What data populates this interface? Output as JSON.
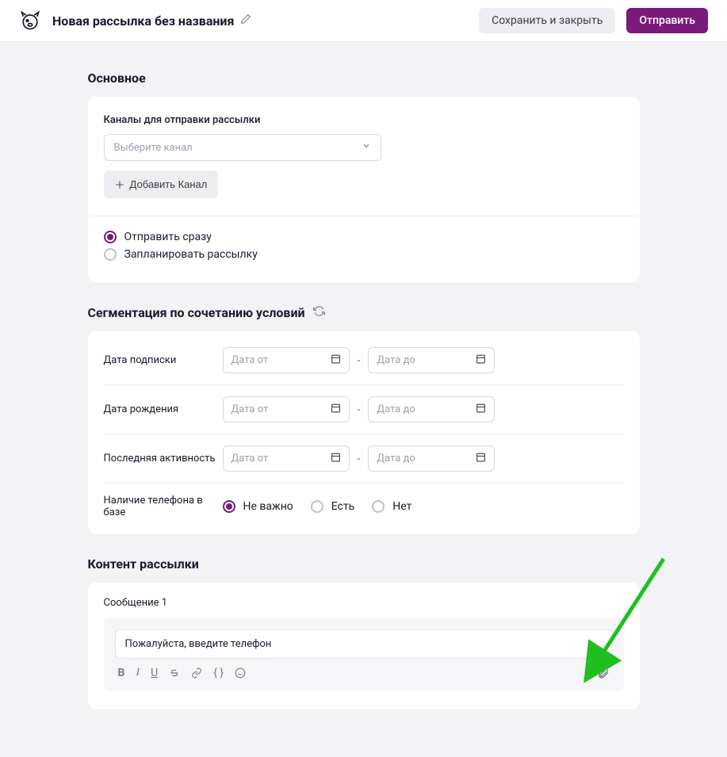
{
  "header": {
    "title": "Новая рассылка без названия",
    "save_close": "Сохранить и закрыть",
    "send": "Отправить"
  },
  "main": {
    "section_title": "Основное",
    "channels_label": "Каналы для отправки рассылки",
    "select_placeholder": "Выберите канал",
    "add_channel": "Добавить Канал",
    "send_now": "Отправить сразу",
    "schedule": "Запланировать рассылку"
  },
  "segmentation": {
    "title": "Сегментация по сочетанию условий",
    "rows": {
      "subscription": "Дата подписки",
      "birth": "Дата рождения",
      "activity": "Последняя активность",
      "phone": "Наличие телефона в базе"
    },
    "date_from": "Дата от",
    "date_to": "Дата до",
    "phone_options": {
      "any": "Не важно",
      "yes": "Есть",
      "no": "Нет"
    }
  },
  "content": {
    "title": "Контент рассылки",
    "message_label": "Сообщение 1",
    "message_text": "Пожалуйста, введите телефон"
  }
}
